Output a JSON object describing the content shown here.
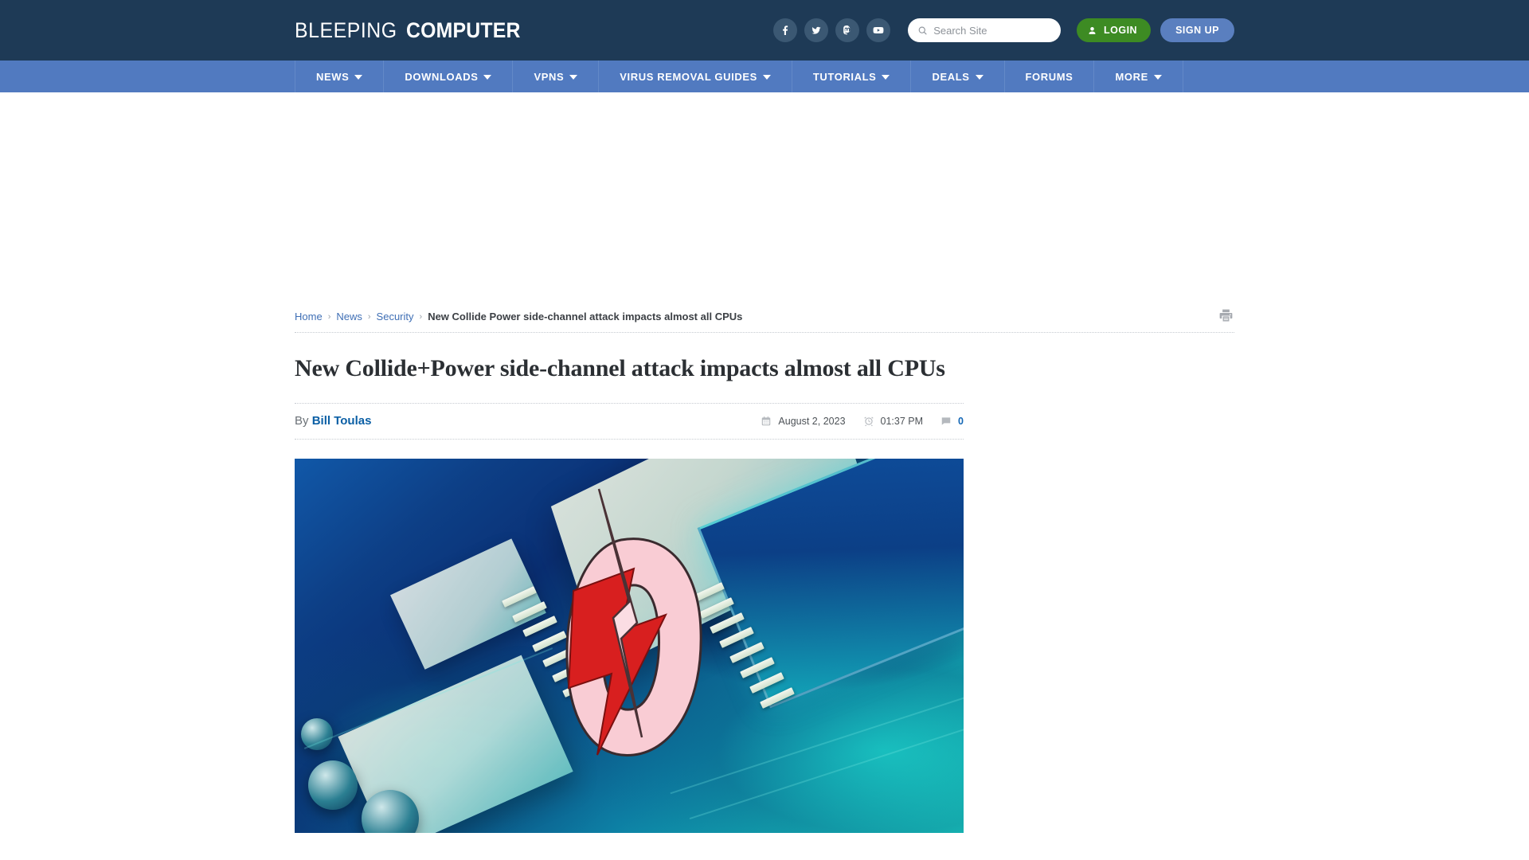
{
  "site": {
    "logo_light": "BLEEPING",
    "logo_bold": "COMPUTER"
  },
  "header": {
    "socials": [
      {
        "name": "facebook-icon",
        "label": "Facebook"
      },
      {
        "name": "twitter-icon",
        "label": "Twitter"
      },
      {
        "name": "mastodon-icon",
        "label": "Mastodon"
      },
      {
        "name": "youtube-icon",
        "label": "YouTube"
      }
    ],
    "search": {
      "placeholder": "Search Site",
      "value": ""
    },
    "login_label": "LOGIN",
    "signup_label": "SIGN UP",
    "colors": {
      "header_bg": "#1e3a56",
      "nav_bg": "#517ac0",
      "login_green": "#3d8b23",
      "signup_blue": "#5a7fbf"
    }
  },
  "nav": {
    "items": [
      {
        "label": "NEWS",
        "has_dropdown": true
      },
      {
        "label": "DOWNLOADS",
        "has_dropdown": true
      },
      {
        "label": "VPNS",
        "has_dropdown": true
      },
      {
        "label": "VIRUS REMOVAL GUIDES",
        "has_dropdown": true
      },
      {
        "label": "TUTORIALS",
        "has_dropdown": true
      },
      {
        "label": "DEALS",
        "has_dropdown": true
      },
      {
        "label": "FORUMS",
        "has_dropdown": false
      },
      {
        "label": "MORE",
        "has_dropdown": true
      }
    ]
  },
  "breadcrumb": {
    "items": [
      {
        "label": "Home",
        "link": true
      },
      {
        "label": "News",
        "link": true
      },
      {
        "label": "Security",
        "link": true
      },
      {
        "label": "New Collide Power side-channel attack impacts almost all CPUs",
        "link": false
      }
    ],
    "separator": "›"
  },
  "article": {
    "title": "New Collide+Power side-channel attack impacts almost all CPUs",
    "by_label": "By",
    "author": "Bill Toulas",
    "date": "August 2, 2023",
    "time": "01:37 PM",
    "comment_count": "0",
    "hero_alt": "Collide+Power logo over a CPU circuit board"
  },
  "actions": {
    "print_label": "Print"
  }
}
